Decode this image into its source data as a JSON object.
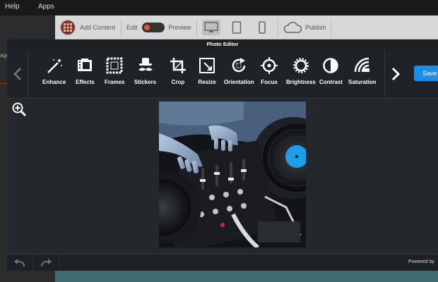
{
  "menu": {
    "help": "Help",
    "apps": "Apps"
  },
  "app_toolbar": {
    "add_content": "Add Content",
    "edit": "Edit",
    "preview": "Preview",
    "publish": "Publish"
  },
  "left_panel": {
    "partial_label": "age"
  },
  "editor": {
    "title": "Photo Editor",
    "save_label": "Save",
    "powered_by": "Powered by",
    "tools": [
      {
        "label": "Enhance",
        "icon": "magic-wand-icon"
      },
      {
        "label": "Effects",
        "icon": "film-icon"
      },
      {
        "label": "Frames",
        "icon": "frame-icon"
      },
      {
        "label": "Stickers",
        "icon": "mustache-hat-icon"
      },
      {
        "label": "Crop",
        "icon": "crop-icon"
      },
      {
        "label": "Resize",
        "icon": "resize-icon"
      },
      {
        "label": "Orientation",
        "icon": "rotate-icon"
      },
      {
        "label": "Focus",
        "icon": "target-icon"
      },
      {
        "label": "Brightness",
        "icon": "sun-icon"
      },
      {
        "label": "Contrast",
        "icon": "contrast-icon"
      },
      {
        "label": "Saturation",
        "icon": "saturation-icon"
      }
    ]
  },
  "colors": {
    "accent": "#1c8ee9",
    "modal_bg": "#23272b",
    "toolbar_bg": "#1f2327"
  }
}
